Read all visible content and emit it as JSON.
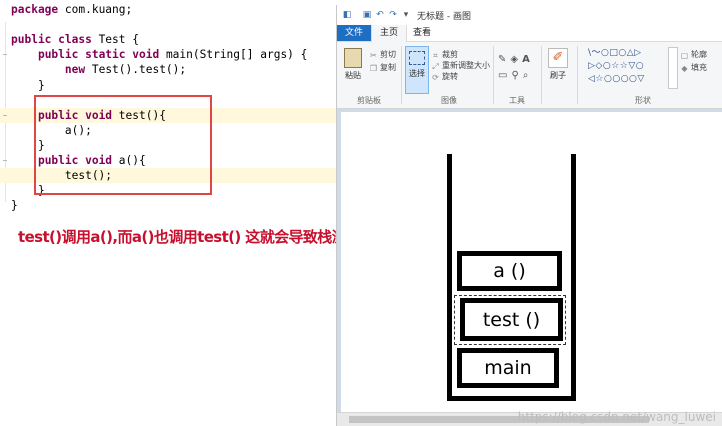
{
  "editor": {
    "lines": [
      [
        {
          "t": "package ",
          "kw": true
        },
        {
          "t": "com.kuang;"
        }
      ],
      [],
      [
        {
          "t": "public class ",
          "kw": true
        },
        {
          "t": "Test {"
        }
      ],
      [
        {
          "t": "    "
        },
        {
          "t": "public static void ",
          "kw": true
        },
        {
          "t": "main(String[] args) {"
        }
      ],
      [
        {
          "t": "        "
        },
        {
          "t": "new ",
          "kw": true
        },
        {
          "t": "Test().test();"
        }
      ],
      [
        {
          "t": "    }"
        }
      ],
      [],
      [
        {
          "t": "    "
        },
        {
          "t": "public void ",
          "kw": true
        },
        {
          "t": "test(){"
        }
      ],
      [
        {
          "t": "        a();"
        }
      ],
      [
        {
          "t": "    }"
        }
      ],
      [
        {
          "t": "    "
        },
        {
          "t": "public void ",
          "kw": true
        },
        {
          "t": "a(){"
        }
      ],
      [
        {
          "t": "        test();"
        }
      ],
      [
        {
          "t": "    }"
        }
      ],
      [
        {
          "t": "}"
        }
      ]
    ],
    "caption": "test()调用a(),而a()也调用test() 这就会导致栈溢出,"
  },
  "paint": {
    "title": "无标题 - 画图",
    "tabs": {
      "file": "文件",
      "home": "主页",
      "view": "查看"
    },
    "clipboard": {
      "paste": "粘贴",
      "cut": "剪切",
      "copy": "复制",
      "label": "剪贴板"
    },
    "image": {
      "select": "选择",
      "crop": "裁剪",
      "resize": "重新调整大小",
      "rotate": "旋转",
      "label": "图像"
    },
    "tools": {
      "label": "工具"
    },
    "brushes": {
      "label": "刷子"
    },
    "shapes": {
      "outline": "轮廓",
      "fill": "填充",
      "label": "形状",
      "glyphs": "\\〜○□○△▷\n▷◇○☆☆▽○\n◁☆○○○○▽"
    },
    "stack": [
      "a ()",
      "test ()",
      "main"
    ]
  },
  "watermark": "https://blog.csdn.net/wang_luwei",
  "colors": {
    "keyword": "#7f0055",
    "caption": "#c8102e",
    "highlight": "#e04646",
    "ribbon_accent": "#1e6ec4"
  }
}
